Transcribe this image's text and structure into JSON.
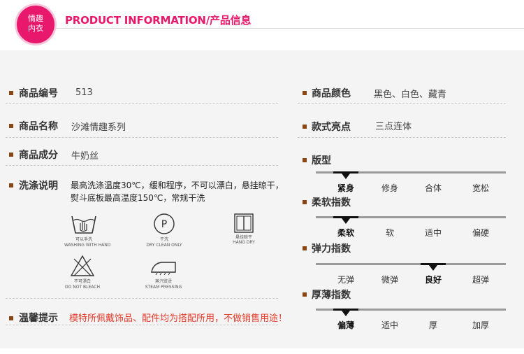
{
  "header": {
    "logo_line1": "情趣",
    "logo_line2": "内衣",
    "title": "PRODUCT INFORMATION/产品信息"
  },
  "left": {
    "code": {
      "label": "商品编号",
      "value": "513"
    },
    "name": {
      "label": "商品名称",
      "value": "沙滩情趣系列"
    },
    "material": {
      "label": "商品成分",
      "value": "牛奶丝"
    },
    "care": {
      "label": "洗涤说明",
      "line1": "最高洗涤温度30℃，缓和程序，不可以漂白，悬挂晾干，",
      "line2": "熨斗底板最高温度150℃，常规干洗",
      "icons": [
        {
          "icon": "hand-wash-icon",
          "cn": "可以手洗",
          "en": "WASHING WITH HAND"
        },
        {
          "icon": "dry-clean-icon",
          "cn": "干洗",
          "en": "DRY CLEAN ONLY"
        },
        {
          "icon": "hang-dry-icon",
          "cn": "悬挂晾干",
          "en": "HANG DRY"
        },
        {
          "icon": "no-bleach-icon",
          "cn": "不可漂白",
          "en": "DO NOT BLEACH"
        },
        {
          "icon": "steam-iron-icon",
          "cn": "蒸汽熨烫",
          "en": "STEAM PRESSING"
        }
      ]
    },
    "tip": {
      "label": "温馨提示",
      "value": "模特所佩戴饰品、配件均为搭配所用，不做销售用途！"
    }
  },
  "right": {
    "color": {
      "label": "商品颜色",
      "value": "黑色、白色、藏青"
    },
    "style": {
      "label": "款式亮点",
      "value": "三点连体"
    },
    "scales": [
      {
        "label": "版型",
        "options": [
          "紧身",
          "修身",
          "合体",
          "宽松"
        ],
        "selected_index": 0
      },
      {
        "label": "柔软指数",
        "options": [
          "柔软",
          "软",
          "适中",
          "偏硬"
        ],
        "selected_index": 0
      },
      {
        "label": "弹力指数",
        "options": [
          "无弹",
          "微弹",
          "良好",
          "超弹"
        ],
        "selected_index": 2
      },
      {
        "label": "厚薄指数",
        "options": [
          "偏薄",
          "适中",
          "厚",
          "加厚"
        ],
        "selected_index": 0
      }
    ]
  },
  "colors": {
    "accent": "#e8186c",
    "bullet": "#8b4513",
    "warning": "#e43b2a",
    "panel": "#f4f4f4"
  }
}
